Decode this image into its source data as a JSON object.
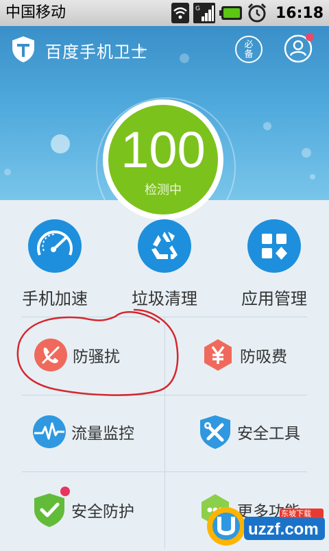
{
  "status_bar": {
    "carrier": "中国移动",
    "time": "16:18"
  },
  "header": {
    "app_title": "百度手机卫士",
    "must_have_label": "必备"
  },
  "score": {
    "value": "100",
    "status": "检测中"
  },
  "main_tools": [
    {
      "label": "手机加速",
      "icon": "speedometer-icon"
    },
    {
      "label": "垃圾清理",
      "icon": "recycle-icon"
    },
    {
      "label": "应用管理",
      "icon": "app-grid-icon"
    }
  ],
  "features": [
    {
      "label": "防骚扰",
      "icon": "phone-block-icon"
    },
    {
      "label": "防吸费",
      "icon": "yuan-icon"
    },
    {
      "label": "流量监控",
      "icon": "traffic-icon"
    },
    {
      "label": "安全工具",
      "icon": "shield-tools-icon"
    },
    {
      "label": "安全防护",
      "icon": "shield-check-icon"
    },
    {
      "label": "更多功能",
      "icon": "more-icon"
    }
  ],
  "watermark": {
    "text": "uzzf.com",
    "sub": "东坡下载"
  },
  "colors": {
    "header": "#4fa9dc",
    "score_green": "#7cc21d",
    "icon_blue": "#1e8fdc",
    "annotation_red": "#d6262e"
  }
}
